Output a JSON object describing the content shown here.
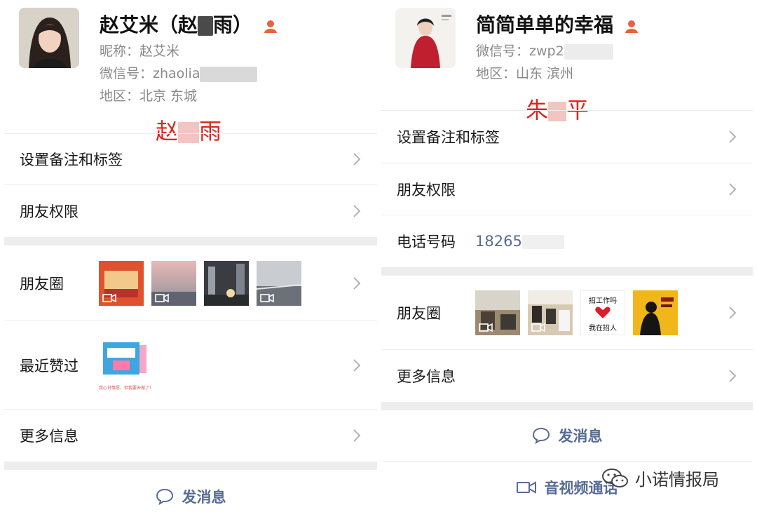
{
  "left": {
    "name_part1": "赵艾米（赵",
    "name_part2": "雨）",
    "nickname": "昵称：赵艾米",
    "wechat_id": "微信号：zhaolia",
    "region": "地区：北京  东城",
    "note_part1": "赵",
    "note_part2": "雨",
    "rows": {
      "remark": "设置备注和标签",
      "permission": "朋友权限",
      "moments": "朋友圈",
      "liked": "最近赞过",
      "more": "更多信息"
    },
    "liked_caption": "我心甘情愿，但我要去做了!",
    "send_message": "发消息"
  },
  "right": {
    "name": "简简单单的幸福",
    "wechat_id": "微信号：zwp2",
    "region": "地区：山东  滨州",
    "note_part1": "朱",
    "note_part2": "平",
    "rows": {
      "remark": "设置备注和标签",
      "permission": "朋友权限",
      "phone_label": "电话号码",
      "phone_value": "18265",
      "moments": "朋友圈",
      "more": "更多信息"
    },
    "poster_top": "招工作吗",
    "poster_bottom": "我在招人",
    "send_message": "发消息",
    "video_call": "音视频通话"
  },
  "watermark": "小诺情报局",
  "colors": {
    "link_blue": "#576b95",
    "annotation_red": "#e0241c",
    "person_icon_orange": "#e8623b",
    "divider_gray": "#ececec",
    "section_gap": "#ededed"
  },
  "icons": [
    "person-badge-icon",
    "chevron-right-icon",
    "video-camera-icon",
    "chat-bubble-icon",
    "wechat-logo-icon"
  ]
}
